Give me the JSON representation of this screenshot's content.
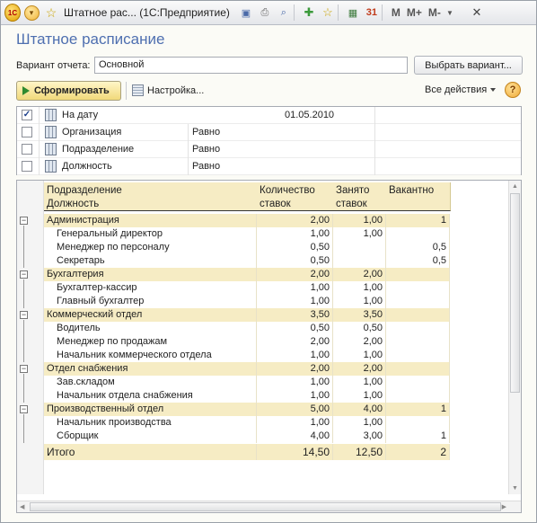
{
  "titlebar": {
    "logo": "1С",
    "title": "Штатное рас...  (1С:Предприятие)",
    "m_labels": [
      "M",
      "M+",
      "M-"
    ],
    "icons": [
      "dropdown-icon",
      "star-icon",
      "save-icon",
      "print-icon",
      "preview-icon",
      "favorite-add-icon",
      "bookmark-icon",
      "calculator-icon",
      "calendar-icon",
      "close-icon"
    ]
  },
  "form": {
    "title": "Штатное расписание",
    "variant_label": "Вариант отчета:",
    "variant_value": "Основной",
    "choose_variant_button": "Выбрать вариант...",
    "generate_button": "Сформировать",
    "settings_button": "Настройка...",
    "all_actions_button": "Все действия",
    "help_button": "?"
  },
  "filters": [
    {
      "checked": true,
      "name": "На дату",
      "condition": "",
      "value": "01.05.2010"
    },
    {
      "checked": false,
      "name": "Организация",
      "condition": "Равно",
      "value": ""
    },
    {
      "checked": false,
      "name": "Подразделение",
      "condition": "Равно",
      "value": ""
    },
    {
      "checked": false,
      "name": "Должность",
      "condition": "Равно",
      "value": ""
    }
  ],
  "report": {
    "headers": {
      "name_line1": "Подразделение",
      "name_line2": "Должность",
      "qty_line1": "Количество",
      "qty_line2": "ставок",
      "occupied_line1": "Занято",
      "occupied_line2": "ставок",
      "vacant": "Вакантно"
    },
    "rows": [
      {
        "type": "group",
        "name": "Администрация",
        "qty": "2,00",
        "occupied": "1,00",
        "vacant": "1"
      },
      {
        "type": "item",
        "name": "Генеральный директор",
        "qty": "1,00",
        "occupied": "1,00",
        "vacant": ""
      },
      {
        "type": "item",
        "name": "Менеджер по персоналу",
        "qty": "0,50",
        "occupied": "",
        "vacant": "0,5"
      },
      {
        "type": "item",
        "name": "Секретарь",
        "qty": "0,50",
        "occupied": "",
        "vacant": "0,5"
      },
      {
        "type": "group",
        "name": "Бухгалтерия",
        "qty": "2,00",
        "occupied": "2,00",
        "vacant": ""
      },
      {
        "type": "item",
        "name": "Бухгалтер-кассир",
        "qty": "1,00",
        "occupied": "1,00",
        "vacant": ""
      },
      {
        "type": "item",
        "name": "Главный бухгалтер",
        "qty": "1,00",
        "occupied": "1,00",
        "vacant": ""
      },
      {
        "type": "group",
        "name": "Коммерческий отдел",
        "qty": "3,50",
        "occupied": "3,50",
        "vacant": ""
      },
      {
        "type": "item",
        "name": "Водитель",
        "qty": "0,50",
        "occupied": "0,50",
        "vacant": ""
      },
      {
        "type": "item",
        "name": "Менеджер по продажам",
        "qty": "2,00",
        "occupied": "2,00",
        "vacant": ""
      },
      {
        "type": "item",
        "name": "Начальник коммерческого отдела",
        "qty": "1,00",
        "occupied": "1,00",
        "vacant": ""
      },
      {
        "type": "group",
        "name": "Отдел снабжения",
        "qty": "2,00",
        "occupied": "2,00",
        "vacant": ""
      },
      {
        "type": "item",
        "name": "Зав.складом",
        "qty": "1,00",
        "occupied": "1,00",
        "vacant": ""
      },
      {
        "type": "item",
        "name": "Начальник отдела снабжения",
        "qty": "1,00",
        "occupied": "1,00",
        "vacant": ""
      },
      {
        "type": "group",
        "name": "Производственный отдел",
        "qty": "5,00",
        "occupied": "4,00",
        "vacant": "1"
      },
      {
        "type": "item",
        "name": "Начальник производства",
        "qty": "1,00",
        "occupied": "1,00",
        "vacant": ""
      },
      {
        "type": "item",
        "name": "Сборщик",
        "qty": "4,00",
        "occupied": "3,00",
        "vacant": "1"
      }
    ],
    "total": {
      "name": "Итого",
      "qty": "14,50",
      "occupied": "12,50",
      "vacant": "2"
    }
  }
}
